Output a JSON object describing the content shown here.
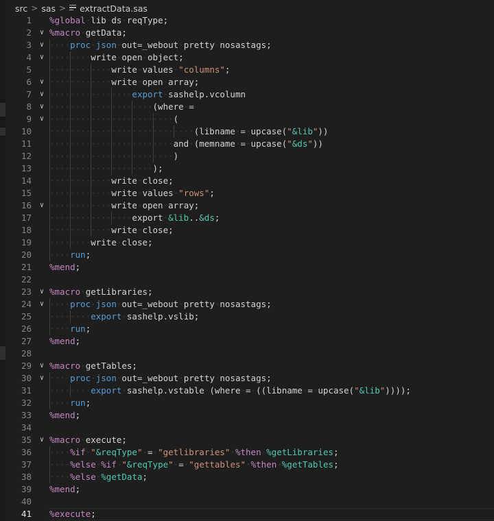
{
  "breadcrumb": {
    "folder1": "src",
    "folder2": "sas",
    "file": "extractData.sas",
    "separator": ">"
  },
  "current_line": 41,
  "code_lines": [
    {
      "n": "1",
      "fold": false,
      "guides": 0,
      "tokens": [
        [
          "k",
          "%global"
        ],
        [
          "ws",
          "·"
        ],
        [
          "p",
          "lib"
        ],
        [
          "ws",
          "·"
        ],
        [
          "p",
          "ds"
        ],
        [
          "ws",
          "·"
        ],
        [
          "p",
          "reqType;"
        ]
      ]
    },
    {
      "n": "2",
      "fold": true,
      "guides": 0,
      "tokens": [
        [
          "k",
          "%macro"
        ],
        [
          "ws",
          "·"
        ],
        [
          "p",
          "getData;"
        ]
      ]
    },
    {
      "n": "3",
      "fold": true,
      "guides": 1,
      "tokens": [
        [
          "ws",
          "····"
        ],
        [
          "b",
          "proc"
        ],
        [
          "ws",
          "·"
        ],
        [
          "b",
          "json"
        ],
        [
          "ws",
          "·"
        ],
        [
          "p",
          "out=_webout"
        ],
        [
          "ws",
          "·"
        ],
        [
          "p",
          "pretty"
        ],
        [
          "ws",
          "·"
        ],
        [
          "p",
          "nosastags;"
        ]
      ]
    },
    {
      "n": "4",
      "fold": true,
      "guides": 2,
      "tokens": [
        [
          "ws",
          "········"
        ],
        [
          "p",
          "write"
        ],
        [
          "ws",
          "·"
        ],
        [
          "p",
          "open"
        ],
        [
          "ws",
          "·"
        ],
        [
          "p",
          "object;"
        ]
      ]
    },
    {
      "n": "5",
      "fold": false,
      "guides": 3,
      "tokens": [
        [
          "ws",
          "············"
        ],
        [
          "p",
          "write"
        ],
        [
          "ws",
          "·"
        ],
        [
          "p",
          "values"
        ],
        [
          "ws",
          "·"
        ],
        [
          "s",
          "\"columns\""
        ],
        [
          "p",
          ";"
        ]
      ]
    },
    {
      "n": "6",
      "fold": true,
      "guides": 3,
      "tokens": [
        [
          "ws",
          "············"
        ],
        [
          "p",
          "write"
        ],
        [
          "ws",
          "·"
        ],
        [
          "p",
          "open"
        ],
        [
          "ws",
          "·"
        ],
        [
          "p",
          "array;"
        ]
      ]
    },
    {
      "n": "7",
      "fold": true,
      "guides": 4,
      "tokens": [
        [
          "ws",
          "················"
        ],
        [
          "b",
          "export"
        ],
        [
          "ws",
          "·"
        ],
        [
          "p",
          "sashelp.vcolumn"
        ]
      ]
    },
    {
      "n": "8",
      "fold": true,
      "guides": 5,
      "tokens": [
        [
          "ws",
          "····················"
        ],
        [
          "p",
          "(where"
        ],
        [
          "ws",
          "·"
        ],
        [
          "p",
          "="
        ]
      ]
    },
    {
      "n": "9",
      "fold": true,
      "guides": 6,
      "tokens": [
        [
          "ws",
          "························"
        ],
        [
          "p",
          "("
        ]
      ]
    },
    {
      "n": "10",
      "fold": false,
      "guides": 7,
      "tokens": [
        [
          "ws",
          "····························"
        ],
        [
          "p",
          "(libname"
        ],
        [
          "ws",
          "·"
        ],
        [
          "p",
          "="
        ],
        [
          "ws",
          "·"
        ],
        [
          "p",
          "upcase("
        ],
        [
          "s",
          "\""
        ],
        [
          "m",
          "&lib"
        ],
        [
          "s",
          "\""
        ],
        [
          "p",
          "))"
        ]
      ]
    },
    {
      "n": "11",
      "fold": false,
      "guides": 6,
      "tokens": [
        [
          "ws",
          "························"
        ],
        [
          "p",
          "and"
        ],
        [
          "ws",
          "·"
        ],
        [
          "p",
          "(memname"
        ],
        [
          "ws",
          "·"
        ],
        [
          "p",
          "="
        ],
        [
          "ws",
          "·"
        ],
        [
          "p",
          "upcase("
        ],
        [
          "s",
          "\""
        ],
        [
          "m",
          "&ds"
        ],
        [
          "s",
          "\""
        ],
        [
          "p",
          "))"
        ]
      ]
    },
    {
      "n": "12",
      "fold": false,
      "guides": 6,
      "tokens": [
        [
          "ws",
          "························"
        ],
        [
          "p",
          ")"
        ]
      ]
    },
    {
      "n": "13",
      "fold": false,
      "guides": 5,
      "tokens": [
        [
          "ws",
          "····················"
        ],
        [
          "p",
          ");"
        ]
      ]
    },
    {
      "n": "14",
      "fold": false,
      "guides": 3,
      "tokens": [
        [
          "ws",
          "············"
        ],
        [
          "p",
          "write"
        ],
        [
          "ws",
          "·"
        ],
        [
          "p",
          "close;"
        ]
      ]
    },
    {
      "n": "15",
      "fold": false,
      "guides": 3,
      "tokens": [
        [
          "ws",
          "············"
        ],
        [
          "p",
          "write"
        ],
        [
          "ws",
          "·"
        ],
        [
          "p",
          "values"
        ],
        [
          "ws",
          "·"
        ],
        [
          "s",
          "\"rows\""
        ],
        [
          "p",
          ";"
        ]
      ]
    },
    {
      "n": "16",
      "fold": true,
      "guides": 3,
      "tokens": [
        [
          "ws",
          "············"
        ],
        [
          "p",
          "write"
        ],
        [
          "ws",
          "·"
        ],
        [
          "p",
          "open"
        ],
        [
          "ws",
          "·"
        ],
        [
          "p",
          "array;"
        ]
      ]
    },
    {
      "n": "17",
      "fold": false,
      "guides": 4,
      "tokens": [
        [
          "ws",
          "················"
        ],
        [
          "p",
          "export"
        ],
        [
          "ws",
          "·"
        ],
        [
          "m",
          "&lib"
        ],
        [
          "p",
          ".."
        ],
        [
          "m",
          "&ds"
        ],
        [
          "p",
          ";"
        ]
      ]
    },
    {
      "n": "18",
      "fold": false,
      "guides": 3,
      "tokens": [
        [
          "ws",
          "············"
        ],
        [
          "p",
          "write"
        ],
        [
          "ws",
          "·"
        ],
        [
          "p",
          "close;"
        ]
      ]
    },
    {
      "n": "19",
      "fold": false,
      "guides": 2,
      "tokens": [
        [
          "ws",
          "········"
        ],
        [
          "p",
          "write"
        ],
        [
          "ws",
          "·"
        ],
        [
          "p",
          "close;"
        ]
      ]
    },
    {
      "n": "20",
      "fold": false,
      "guides": 1,
      "tokens": [
        [
          "ws",
          "····"
        ],
        [
          "b",
          "run"
        ],
        [
          "p",
          ";"
        ]
      ]
    },
    {
      "n": "21",
      "fold": false,
      "guides": 0,
      "tokens": [
        [
          "k",
          "%mend"
        ],
        [
          "p",
          ";"
        ]
      ]
    },
    {
      "n": "22",
      "fold": false,
      "guides": 0,
      "tokens": []
    },
    {
      "n": "23",
      "fold": true,
      "guides": 0,
      "tokens": [
        [
          "k",
          "%macro"
        ],
        [
          "ws",
          "·"
        ],
        [
          "p",
          "getLibraries;"
        ]
      ]
    },
    {
      "n": "24",
      "fold": true,
      "guides": 1,
      "tokens": [
        [
          "ws",
          "····"
        ],
        [
          "b",
          "proc"
        ],
        [
          "ws",
          "·"
        ],
        [
          "b",
          "json"
        ],
        [
          "ws",
          "·"
        ],
        [
          "p",
          "out=_webout"
        ],
        [
          "ws",
          "·"
        ],
        [
          "p",
          "pretty"
        ],
        [
          "ws",
          "·"
        ],
        [
          "p",
          "nosastags;"
        ]
      ]
    },
    {
      "n": "25",
      "fold": false,
      "guides": 2,
      "tokens": [
        [
          "ws",
          "········"
        ],
        [
          "b",
          "export"
        ],
        [
          "ws",
          "·"
        ],
        [
          "p",
          "sashelp.vslib;"
        ]
      ]
    },
    {
      "n": "26",
      "fold": false,
      "guides": 1,
      "tokens": [
        [
          "ws",
          "····"
        ],
        [
          "b",
          "run"
        ],
        [
          "p",
          ";"
        ]
      ]
    },
    {
      "n": "27",
      "fold": false,
      "guides": 0,
      "tokens": [
        [
          "k",
          "%mend"
        ],
        [
          "p",
          ";"
        ]
      ]
    },
    {
      "n": "28",
      "fold": false,
      "guides": 0,
      "tokens": []
    },
    {
      "n": "29",
      "fold": true,
      "guides": 0,
      "tokens": [
        [
          "k",
          "%macro"
        ],
        [
          "ws",
          "·"
        ],
        [
          "p",
          "getTables;"
        ]
      ]
    },
    {
      "n": "30",
      "fold": true,
      "guides": 1,
      "tokens": [
        [
          "ws",
          "····"
        ],
        [
          "b",
          "proc"
        ],
        [
          "ws",
          "·"
        ],
        [
          "b",
          "json"
        ],
        [
          "ws",
          "·"
        ],
        [
          "p",
          "out=_webout"
        ],
        [
          "ws",
          "·"
        ],
        [
          "p",
          "pretty"
        ],
        [
          "ws",
          "·"
        ],
        [
          "p",
          "nosastags;"
        ]
      ]
    },
    {
      "n": "31",
      "fold": false,
      "guides": 2,
      "tokens": [
        [
          "ws",
          "········"
        ],
        [
          "b",
          "export"
        ],
        [
          "ws",
          "·"
        ],
        [
          "p",
          "sashelp.vstable"
        ],
        [
          "ws",
          "·"
        ],
        [
          "p",
          "(where"
        ],
        [
          "ws",
          "·"
        ],
        [
          "p",
          "="
        ],
        [
          "ws",
          "·"
        ],
        [
          "p",
          "((libname"
        ],
        [
          "ws",
          "·"
        ],
        [
          "p",
          "="
        ],
        [
          "ws",
          "·"
        ],
        [
          "p",
          "upcase("
        ],
        [
          "s",
          "\""
        ],
        [
          "m",
          "&lib"
        ],
        [
          "s",
          "\""
        ],
        [
          "p",
          "))));"
        ]
      ]
    },
    {
      "n": "32",
      "fold": false,
      "guides": 1,
      "tokens": [
        [
          "ws",
          "····"
        ],
        [
          "b",
          "run"
        ],
        [
          "p",
          ";"
        ]
      ]
    },
    {
      "n": "33",
      "fold": false,
      "guides": 0,
      "tokens": [
        [
          "k",
          "%mend"
        ],
        [
          "p",
          ";"
        ]
      ]
    },
    {
      "n": "34",
      "fold": false,
      "guides": 0,
      "tokens": []
    },
    {
      "n": "35",
      "fold": true,
      "guides": 0,
      "tokens": [
        [
          "k",
          "%macro"
        ],
        [
          "ws",
          "·"
        ],
        [
          "p",
          "execute;"
        ]
      ]
    },
    {
      "n": "36",
      "fold": false,
      "guides": 1,
      "tokens": [
        [
          "ws",
          "····"
        ],
        [
          "k",
          "%if"
        ],
        [
          "ws",
          "·"
        ],
        [
          "s",
          "\""
        ],
        [
          "m",
          "&reqType"
        ],
        [
          "s",
          "\""
        ],
        [
          "ws",
          "·"
        ],
        [
          "p",
          "="
        ],
        [
          "ws",
          "·"
        ],
        [
          "s",
          "\"getlibraries\""
        ],
        [
          "ws",
          "·"
        ],
        [
          "k",
          "%then"
        ],
        [
          "ws",
          "·"
        ],
        [
          "m",
          "%getLibraries"
        ],
        [
          "p",
          ";"
        ]
      ]
    },
    {
      "n": "37",
      "fold": false,
      "guides": 1,
      "tokens": [
        [
          "ws",
          "····"
        ],
        [
          "k",
          "%else"
        ],
        [
          "ws",
          "·"
        ],
        [
          "k",
          "%if"
        ],
        [
          "ws",
          "·"
        ],
        [
          "s",
          "\""
        ],
        [
          "m",
          "&reqType"
        ],
        [
          "s",
          "\""
        ],
        [
          "ws",
          "·"
        ],
        [
          "p",
          "="
        ],
        [
          "ws",
          "·"
        ],
        [
          "s",
          "\"gettables\""
        ],
        [
          "ws",
          "·"
        ],
        [
          "k",
          "%then"
        ],
        [
          "ws",
          "·"
        ],
        [
          "m",
          "%getTables"
        ],
        [
          "p",
          ";"
        ]
      ]
    },
    {
      "n": "38",
      "fold": false,
      "guides": 1,
      "tokens": [
        [
          "ws",
          "····"
        ],
        [
          "k",
          "%else"
        ],
        [
          "ws",
          "·"
        ],
        [
          "m",
          "%getData"
        ],
        [
          "p",
          ";"
        ]
      ]
    },
    {
      "n": "39",
      "fold": false,
      "guides": 0,
      "tokens": [
        [
          "k",
          "%mend"
        ],
        [
          "p",
          ";"
        ]
      ]
    },
    {
      "n": "40",
      "fold": false,
      "guides": 0,
      "tokens": []
    },
    {
      "n": "41",
      "fold": false,
      "guides": 0,
      "tokens": [
        [
          "k",
          "%execute"
        ],
        [
          "p",
          ";"
        ]
      ]
    }
  ]
}
